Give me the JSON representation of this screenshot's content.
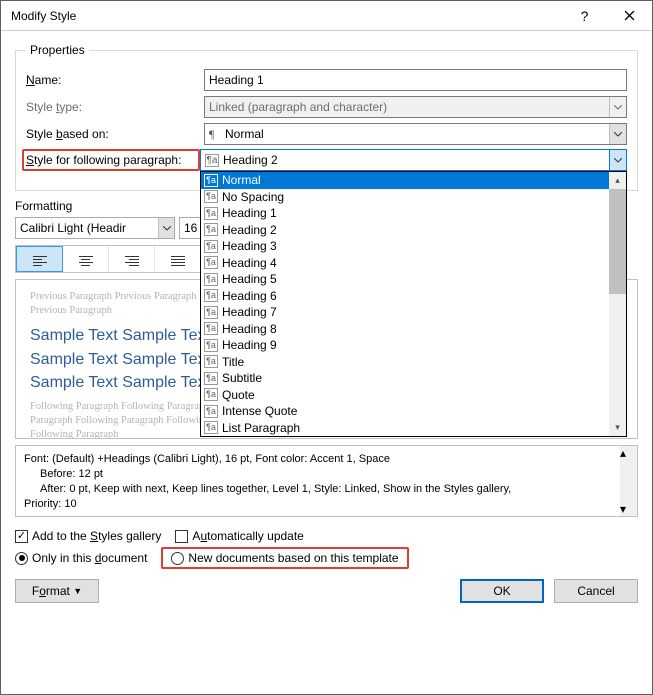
{
  "title": "Modify Style",
  "properties": {
    "legend": "Properties",
    "name_label": "Name:",
    "name_value": "Heading 1",
    "type_label": "Style type:",
    "type_value": "Linked (paragraph and character)",
    "based_label": "Style based on:",
    "based_value": "Normal",
    "following_label": "Style for following paragraph:",
    "following_value": "Heading 2",
    "dropdown_items": [
      "Normal",
      "No Spacing",
      "Heading 1",
      "Heading 2",
      "Heading 3",
      "Heading 4",
      "Heading 5",
      "Heading 6",
      "Heading 7",
      "Heading 8",
      "Heading 9",
      "Title",
      "Subtitle",
      "Quote",
      "Intense Quote",
      "List Paragraph"
    ]
  },
  "formatting": {
    "legend": "Formatting",
    "font": "Calibri Light (Headir",
    "size": "16",
    "preview_ghost_before": "Previous Paragraph Previous Paragraph Previous Paragraph Previous Paragraph Previous Paragraph Previous Paragraph Previous Paragraph Previous Paragraph",
    "preview_sample": "Sample Text Sample Text Sample Text Sample Text Sample Text Sample Text Sample Text Sample Text Sample Text Sample Text Sample Text Sample Text Sample Text Sample Text Sample Text",
    "preview_ghost_after": "Following Paragraph Following Paragraph Following Paragraph Following Paragraph Following Paragraph Following Paragraph Following Paragraph Following Paragraph Following Paragraph Following Paragraph Following Paragraph Following Paragraph Following Paragraph Following Paragraph"
  },
  "description": {
    "line1": "Font: (Default) +Headings (Calibri Light), 16 pt, Font color: Accent 1, Space",
    "line2": "Before:  12 pt",
    "line3": "After:  0 pt, Keep with next, Keep lines together, Level 1, Style: Linked, Show in the Styles gallery,",
    "line4": "Priority: 10"
  },
  "options": {
    "add_gallery": "Add to the Styles gallery",
    "auto_update": "Automatically update",
    "only_doc": "Only in this document",
    "new_docs": "New documents based on this template"
  },
  "buttons": {
    "format": "Format",
    "ok": "OK",
    "cancel": "Cancel"
  }
}
